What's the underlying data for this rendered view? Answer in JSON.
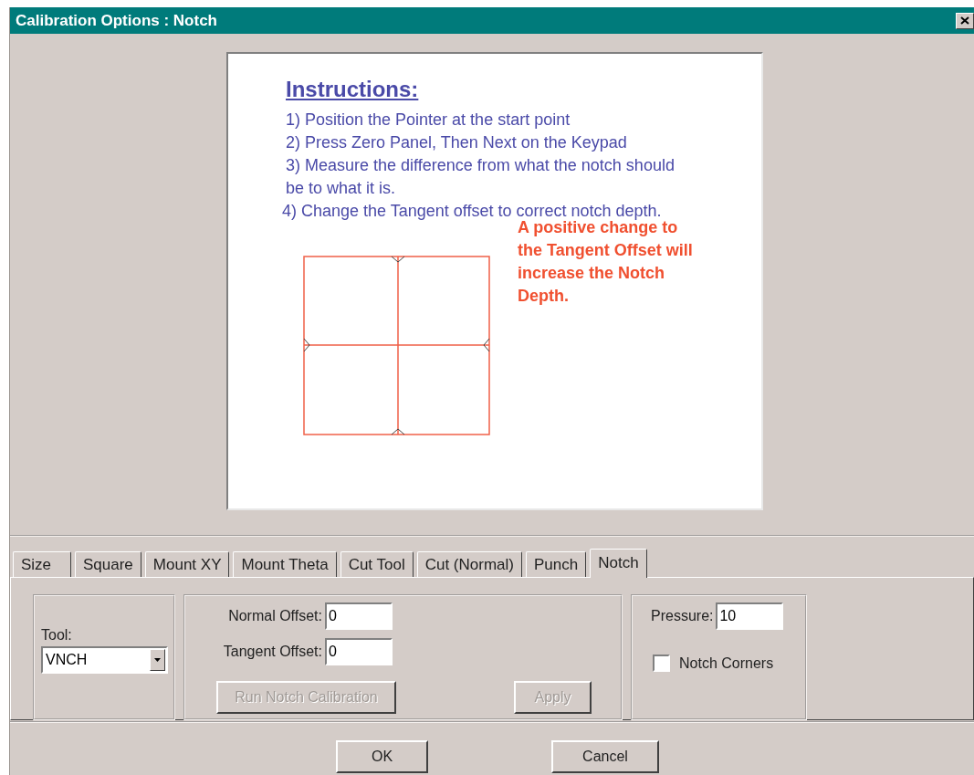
{
  "window": {
    "title": "Calibration Options : Notch"
  },
  "instructions": {
    "heading": "Instructions:",
    "steps": [
      "1) Position the Pointer at the start point",
      "2) Press Zero Panel, Then Next on the Keypad",
      "3) Measure the difference from what the notch should be to what  it is.",
      "4) Change the Tangent offset to correct notch depth."
    ],
    "note": "A positive change to the Tangent Offset will increase the Notch Depth."
  },
  "tabs": [
    {
      "label": "Size",
      "selected": false
    },
    {
      "label": "Square",
      "selected": false
    },
    {
      "label": "Mount XY",
      "selected": false
    },
    {
      "label": "Mount Theta",
      "selected": false
    },
    {
      "label": "Cut Tool",
      "selected": false
    },
    {
      "label": "Cut (Normal)",
      "selected": false
    },
    {
      "label": "Punch",
      "selected": false
    },
    {
      "label": "Notch",
      "selected": true
    }
  ],
  "tool_group": {
    "label": "Tool:",
    "value": "VNCH"
  },
  "offsets": {
    "fields": [
      {
        "label": "Normal Offset:",
        "value": "0"
      },
      {
        "label": "Tangent Offset:",
        "value": "0"
      }
    ],
    "buttons": [
      {
        "label": "Run Notch Calibration",
        "disabled": true
      },
      {
        "label": "Apply",
        "disabled": true
      }
    ]
  },
  "pressure": {
    "label": "Pressure:",
    "value": "10"
  },
  "notch_corners": {
    "label": "Notch Corners",
    "checked": false
  },
  "buttons": [
    {
      "label": "OK",
      "disabled": false
    },
    {
      "label": "Cancel",
      "disabled": false
    }
  ]
}
